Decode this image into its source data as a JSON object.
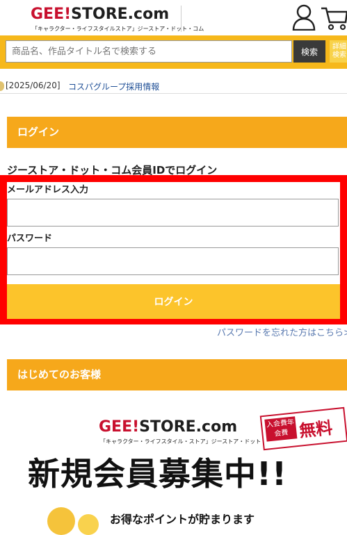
{
  "header": {
    "logo_text": "GEE!STORE.com",
    "logo_subtitle": "「キャラクター・ライフスタイルストア」ジーストア・ドット・コム"
  },
  "search": {
    "placeholder": "商品名、作品タイトル名で検索する",
    "button_label": "検索",
    "detail_label": "詳細検索"
  },
  "news": {
    "date": "[2025/06/20]",
    "link_text": "コスパグループ採用情報"
  },
  "login_section": {
    "heading": "ログイン",
    "member_title": "ジーストア・ドット・コム会員IDでログイン",
    "email_label": "メールアドレス入力",
    "email_value": "",
    "password_label": "パスワード",
    "password_value": "",
    "login_button": "ログイン",
    "forgot_link": "パスワードを忘れた方はこちら>"
  },
  "first_time_section": {
    "heading": "はじめてのお客様"
  },
  "banner": {
    "logo_text": "GEE!STORE.com",
    "logo_subtitle": "「キャラクター・ライフスタイル・ストア」ジーストア・ドット・コム",
    "badge_small": "入会費年会費",
    "badge_big": "無料",
    "headline": "新規会員募集中!!",
    "points_text": "お得なポイントが貯まります"
  },
  "colors": {
    "accent": "#f6a81b",
    "button": "#fcc42b",
    "highlight": "#ff0000",
    "link": "#1f4f96"
  }
}
